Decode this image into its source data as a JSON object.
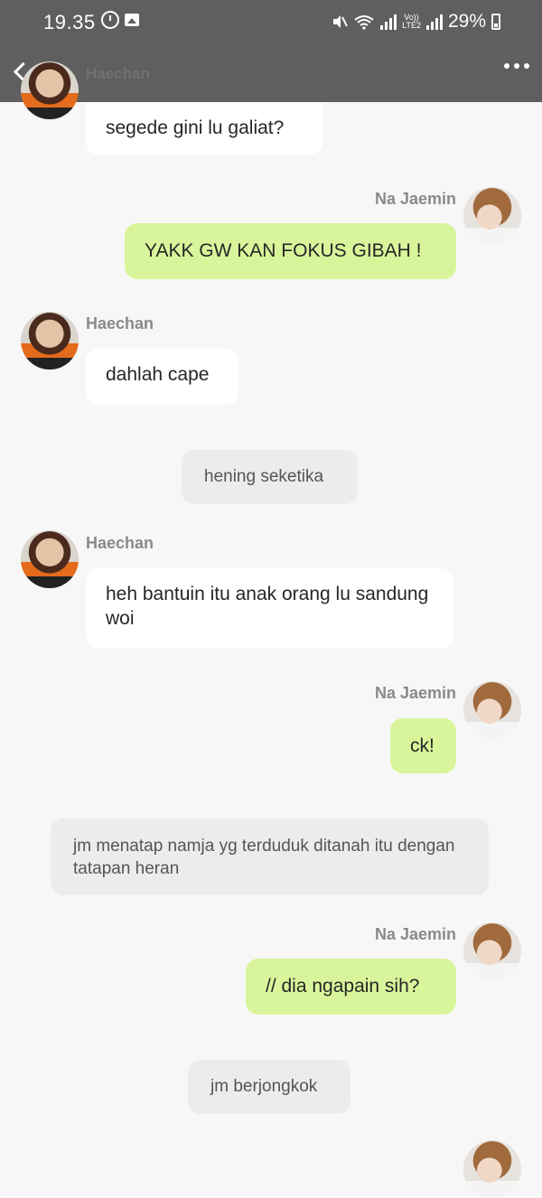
{
  "status_bar": {
    "time": "19.35",
    "battery": "29%",
    "network": "LTE2",
    "volte": "Vo))"
  },
  "header": {
    "title": "Haechan"
  },
  "messages": [
    {
      "sender": "",
      "text": "segede gini lu galiat?"
    },
    {
      "sender": "Na Jaemin",
      "text": "YAKK GW KAN  FOKUS GIBAH !"
    },
    {
      "sender": "Haechan",
      "text": "dahlah cape"
    },
    {
      "narration": "hening seketika"
    },
    {
      "sender": "Haechan",
      "text": "heh bantuin itu anak orang lu sandung woi"
    },
    {
      "sender": "Na Jaemin",
      "text": "ck!"
    },
    {
      "narration": "jm menatap namja yg terduduk ditanah itu dengan tatapan heran"
    },
    {
      "sender": "Na Jaemin",
      "text": "// dia ngapain sih?"
    },
    {
      "narration": "jm berjongkok"
    }
  ]
}
